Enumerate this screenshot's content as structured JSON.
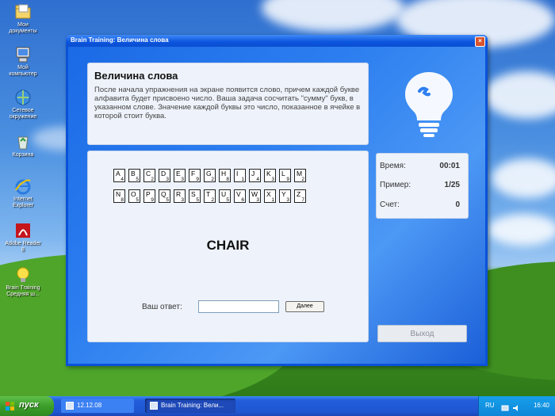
{
  "desktop": {
    "icons": [
      {
        "label": "Мои документы",
        "icon": "folder-icon"
      },
      {
        "label": "Мой компьютер",
        "icon": "computer-icon"
      },
      {
        "label": "Сетевое окружение",
        "icon": "network-icon"
      },
      {
        "label": "Корзина",
        "icon": "recycle-bin-icon"
      },
      {
        "label": "Internet Explorer",
        "icon": "internet-explorer-icon"
      },
      {
        "label": "Adobe Reader 8",
        "icon": "adobe-reader-icon"
      },
      {
        "label": "Brain Training Средняя ш...",
        "icon": "lightbulb-icon"
      }
    ]
  },
  "window": {
    "title": "Brain Training: Величина слова",
    "close_label": "×"
  },
  "info": {
    "heading": "Величина слова",
    "text": "После начала упражнения на экране появится слово, причем каждой букве алфавита будет присвоено число. Ваша задача сосчитать \"сумму\" букв, в указанном слове. Значение каждой буквы это число, показанное в ячейке в которой стоит буква."
  },
  "letters_row1": [
    {
      "l": "A",
      "n": "4"
    },
    {
      "l": "B",
      "n": "5"
    },
    {
      "l": "C",
      "n": "2"
    },
    {
      "l": "D",
      "n": "3"
    },
    {
      "l": "E",
      "n": "3"
    },
    {
      "l": "F",
      "n": "9"
    },
    {
      "l": "G",
      "n": "2"
    },
    {
      "l": "H",
      "n": "8"
    },
    {
      "l": "I",
      "n": "1"
    },
    {
      "l": "J",
      "n": "4"
    },
    {
      "l": "K",
      "n": "3"
    },
    {
      "l": "L",
      "n": "9"
    },
    {
      "l": "M",
      "n": "2"
    }
  ],
  "letters_row2": [
    {
      "l": "N",
      "n": "8"
    },
    {
      "l": "O",
      "n": "5"
    },
    {
      "l": "P",
      "n": "9"
    },
    {
      "l": "Q",
      "n": "5"
    },
    {
      "l": "R",
      "n": "3"
    },
    {
      "l": "S",
      "n": "5"
    },
    {
      "l": "T",
      "n": "2"
    },
    {
      "l": "U",
      "n": "5"
    },
    {
      "l": "V",
      "n": "6"
    },
    {
      "l": "W",
      "n": "3"
    },
    {
      "l": "X",
      "n": "1"
    },
    {
      "l": "Y",
      "n": "3"
    },
    {
      "l": "Z",
      "n": "7"
    }
  ],
  "word": "CHAIR",
  "answer": {
    "label": "Ваш ответ:",
    "value": "",
    "next_label": "Далее"
  },
  "stats": {
    "time_label": "Время:",
    "time_value": "00:01",
    "example_label": "Пример:",
    "example_value": "1/25",
    "score_label": "Счет:",
    "score_value": "0"
  },
  "exit_label": "Выход",
  "taskbar": {
    "start_label": "пуск",
    "button1": "12.12.08",
    "button2": "Brain Training: Вели...",
    "lang": "RU",
    "clock": "16:40"
  },
  "colors": {
    "window_blue": "#0a52d8",
    "panel": "#eef3fb",
    "start_green": "#3c9e2a"
  }
}
